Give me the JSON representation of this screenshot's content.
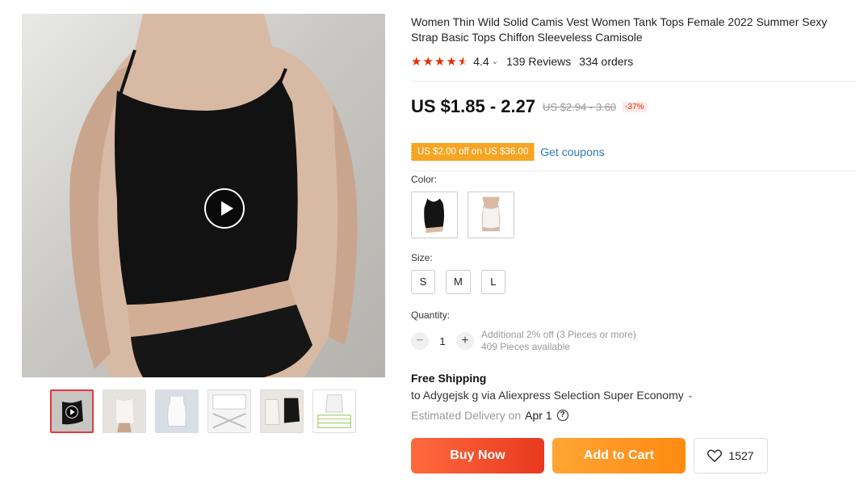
{
  "product": {
    "title": "Women Thin Wild Solid Camis Vest Women Tank Tops Female 2022 Summer Sexy Strap Basic Tops Chiffon Sleeveless Camisole",
    "rating": {
      "stars": 4.4,
      "value": "4.4",
      "reviews": "139 Reviews",
      "orders": "334 orders"
    }
  },
  "price": {
    "current": "US $1.85 - 2.27",
    "original": "US $2.94 - 3.60",
    "discount": "-37%"
  },
  "coupon": {
    "tag": "US $2.00 off on US $36.00",
    "link": "Get coupons"
  },
  "color": {
    "label": "Color:",
    "options": [
      {
        "name": "black"
      },
      {
        "name": "white"
      }
    ]
  },
  "size": {
    "label": "Size:",
    "options": [
      "S",
      "M",
      "L"
    ]
  },
  "quantity": {
    "label": "Quantity:",
    "value": "1",
    "minus": "−",
    "plus": "+",
    "note": "Additional 2% off (3 Pieces or more)",
    "available": "409 Pieces available"
  },
  "shipping": {
    "title": "Free Shipping",
    "route": "to Adygejsk g via Aliexpress Selection Super Economy",
    "delivery_label": "Estimated Delivery on",
    "delivery_date": "Apr 1",
    "help": "?"
  },
  "actions": {
    "buy": "Buy Now",
    "cart": "Add to Cart",
    "wishlist_count": "1527"
  },
  "gallery": {
    "thumbnail_count": 6,
    "active_index": 0
  },
  "colors": {
    "price_red": "#e62e04",
    "coupon_orange": "#f6a523",
    "link_blue": "#2e7ab8",
    "buy_gradient": [
      "#ff6a3d",
      "#e8391f"
    ],
    "cart_gradient": [
      "#ffa534",
      "#ff8a12"
    ]
  }
}
